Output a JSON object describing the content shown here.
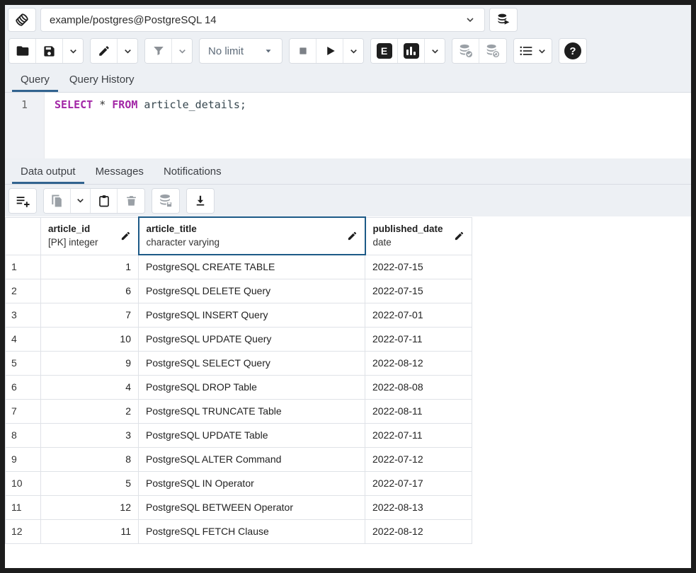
{
  "connection_bar": {
    "connection_label": "example/postgres@PostgreSQL 14"
  },
  "toolbar": {
    "limit_label": "No limit",
    "explain_glyph": "E",
    "help_glyph": "?"
  },
  "query_tabs": [
    {
      "label": "Query",
      "active": true
    },
    {
      "label": "Query History",
      "active": false
    }
  ],
  "editor": {
    "line_number": "1",
    "sql": {
      "kw1": "SELECT",
      "op": " * ",
      "kw2": "FROM",
      "rest": " article_details;"
    }
  },
  "output_tabs": [
    {
      "label": "Data output",
      "active": true
    },
    {
      "label": "Messages",
      "active": false
    },
    {
      "label": "Notifications",
      "active": false
    }
  ],
  "grid": {
    "columns": [
      {
        "name": "article_id",
        "type": "[PK] integer",
        "selected": false
      },
      {
        "name": "article_title",
        "type": "character varying",
        "selected": true
      },
      {
        "name": "published_date",
        "type": "date",
        "selected": false
      }
    ],
    "rows": [
      {
        "num": "1",
        "article_id": "1",
        "article_title": "PostgreSQL CREATE TABLE",
        "published_date": "2022-07-15"
      },
      {
        "num": "2",
        "article_id": "6",
        "article_title": "PostgreSQL DELETE Query",
        "published_date": "2022-07-15"
      },
      {
        "num": "3",
        "article_id": "7",
        "article_title": "PostgreSQL INSERT Query",
        "published_date": "2022-07-01"
      },
      {
        "num": "4",
        "article_id": "10",
        "article_title": "PostgreSQL UPDATE Query",
        "published_date": "2022-07-11"
      },
      {
        "num": "5",
        "article_id": "9",
        "article_title": "PostgreSQL SELECT Query",
        "published_date": "2022-08-12"
      },
      {
        "num": "6",
        "article_id": "4",
        "article_title": "PostgreSQL DROP Table",
        "published_date": "2022-08-08"
      },
      {
        "num": "7",
        "article_id": "2",
        "article_title": "PostgreSQL TRUNCATE Table",
        "published_date": "2022-08-11"
      },
      {
        "num": "8",
        "article_id": "3",
        "article_title": "PostgreSQL UPDATE Table",
        "published_date": "2022-07-11"
      },
      {
        "num": "9",
        "article_id": "8",
        "article_title": "PostgreSQL ALTER Command",
        "published_date": "2022-07-12"
      },
      {
        "num": "10",
        "article_id": "5",
        "article_title": "PostgreSQL IN Operator",
        "published_date": "2022-07-17"
      },
      {
        "num": "11",
        "article_id": "12",
        "article_title": "PostgreSQL BETWEEN Operator",
        "published_date": "2022-08-13"
      },
      {
        "num": "12",
        "article_id": "11",
        "article_title": "PostgreSQL FETCH Clause",
        "published_date": "2022-08-12"
      }
    ]
  },
  "colors": {
    "accent_blue": "#31638f",
    "selected_header_border": "#1d5a87",
    "keyword_purple": "#a226a6",
    "identifier": "#37474f",
    "chrome_bg": "#edf0f4",
    "disabled_gray": "#8b9096",
    "icon_black": "#1e1e1e"
  }
}
